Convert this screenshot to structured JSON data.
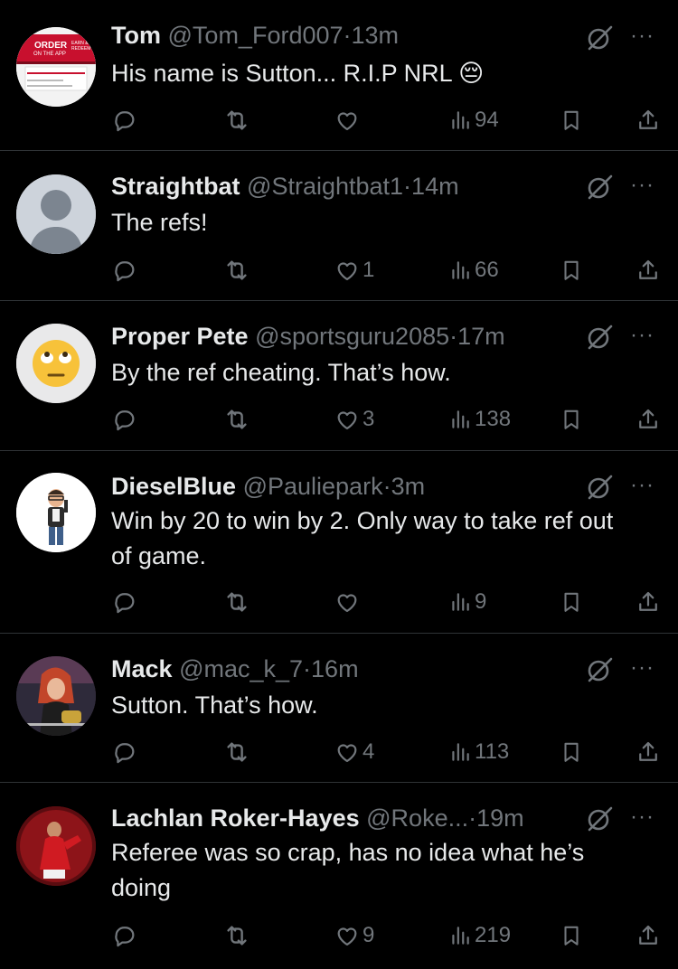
{
  "colors": {
    "background": "#000000",
    "text": "#e7e9ea",
    "muted": "#71767b",
    "divider": "#2f3336"
  },
  "tweets": [
    {
      "name": "Tom",
      "handle": "@Tom_Ford007",
      "sep": "·",
      "time": "13m",
      "text": "His name is Sutton... R.I.P NRL 😔",
      "replies": "",
      "retweets": "",
      "likes": "",
      "views": "94",
      "avatar_texts": [
        "ORDER",
        "ON THE APP",
        "EARN & REDEEM"
      ]
    },
    {
      "name": "Straightbat",
      "handle": "@Straightbat1",
      "sep": "·",
      "time": "14m",
      "text": "The refs!",
      "replies": "",
      "retweets": "",
      "likes": "1",
      "views": "66"
    },
    {
      "name": "Proper Pete",
      "handle": "@sportsguru2085",
      "sep": "·",
      "time": "17m",
      "text": "By the ref cheating. That’s how.",
      "replies": "",
      "retweets": "",
      "likes": "3",
      "views": "138"
    },
    {
      "name": "DieselBlue",
      "handle": "@Pauliepark",
      "sep": "·",
      "time": "3m",
      "text": "Win by 20 to win by 2. Only way to take ref out of game.",
      "replies": "",
      "retweets": "",
      "likes": "",
      "views": "9"
    },
    {
      "name": "Mack",
      "handle": "@mac_k_7",
      "sep": "·",
      "time": "16m",
      "text": "Sutton. That’s how.",
      "replies": "",
      "retweets": "",
      "likes": "4",
      "views": "113"
    },
    {
      "name": "Lachlan Roker-Hayes",
      "handle": "@Roke...",
      "sep": "·",
      "time": "19m",
      "text": "Referee was so crap, has no idea what he’s doing",
      "replies": "",
      "retweets": "",
      "likes": "9",
      "views": "219"
    }
  ],
  "icons": {
    "reply": "reply-icon",
    "retweet": "retweet-icon",
    "like": "heart-icon",
    "views": "views-icon",
    "bookmark": "bookmark-icon",
    "share": "share-icon",
    "grok": "grok-icon",
    "more": "more-icon"
  },
  "more_glyph": "···"
}
